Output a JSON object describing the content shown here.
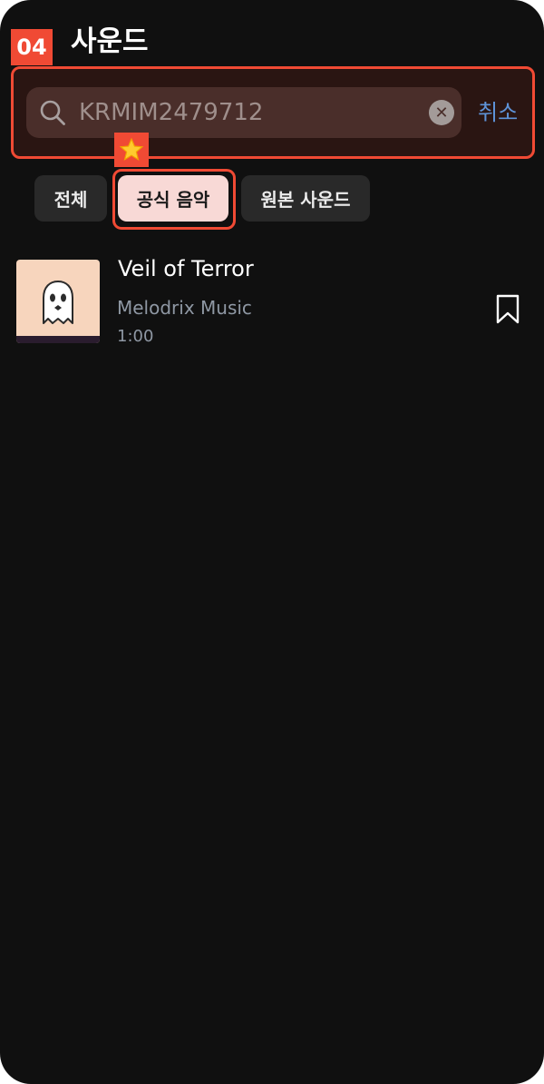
{
  "header": {
    "step_badge": "04",
    "title": "사운드"
  },
  "search": {
    "placeholder": "",
    "value": "KRMIM2479712",
    "clear_icon": "close-circle-icon",
    "cancel_label": "취소"
  },
  "filters": {
    "chips": [
      {
        "label": "전체",
        "selected": false
      },
      {
        "label": "공식 음악",
        "selected": true
      },
      {
        "label": "원본 사운드",
        "selected": false
      }
    ],
    "highlight_icon": "star-icon"
  },
  "results": [
    {
      "title": "Veil of Terror",
      "artist": "Melodrix Music",
      "duration": "1:00",
      "art_icon": "ghost-icon",
      "bookmark_icon": "bookmark-icon"
    }
  ],
  "colors": {
    "background": "#101010",
    "accent_highlight": "#f04a34",
    "cancel_link": "#5e93d8",
    "selected_chip": "#f8d9d6"
  }
}
